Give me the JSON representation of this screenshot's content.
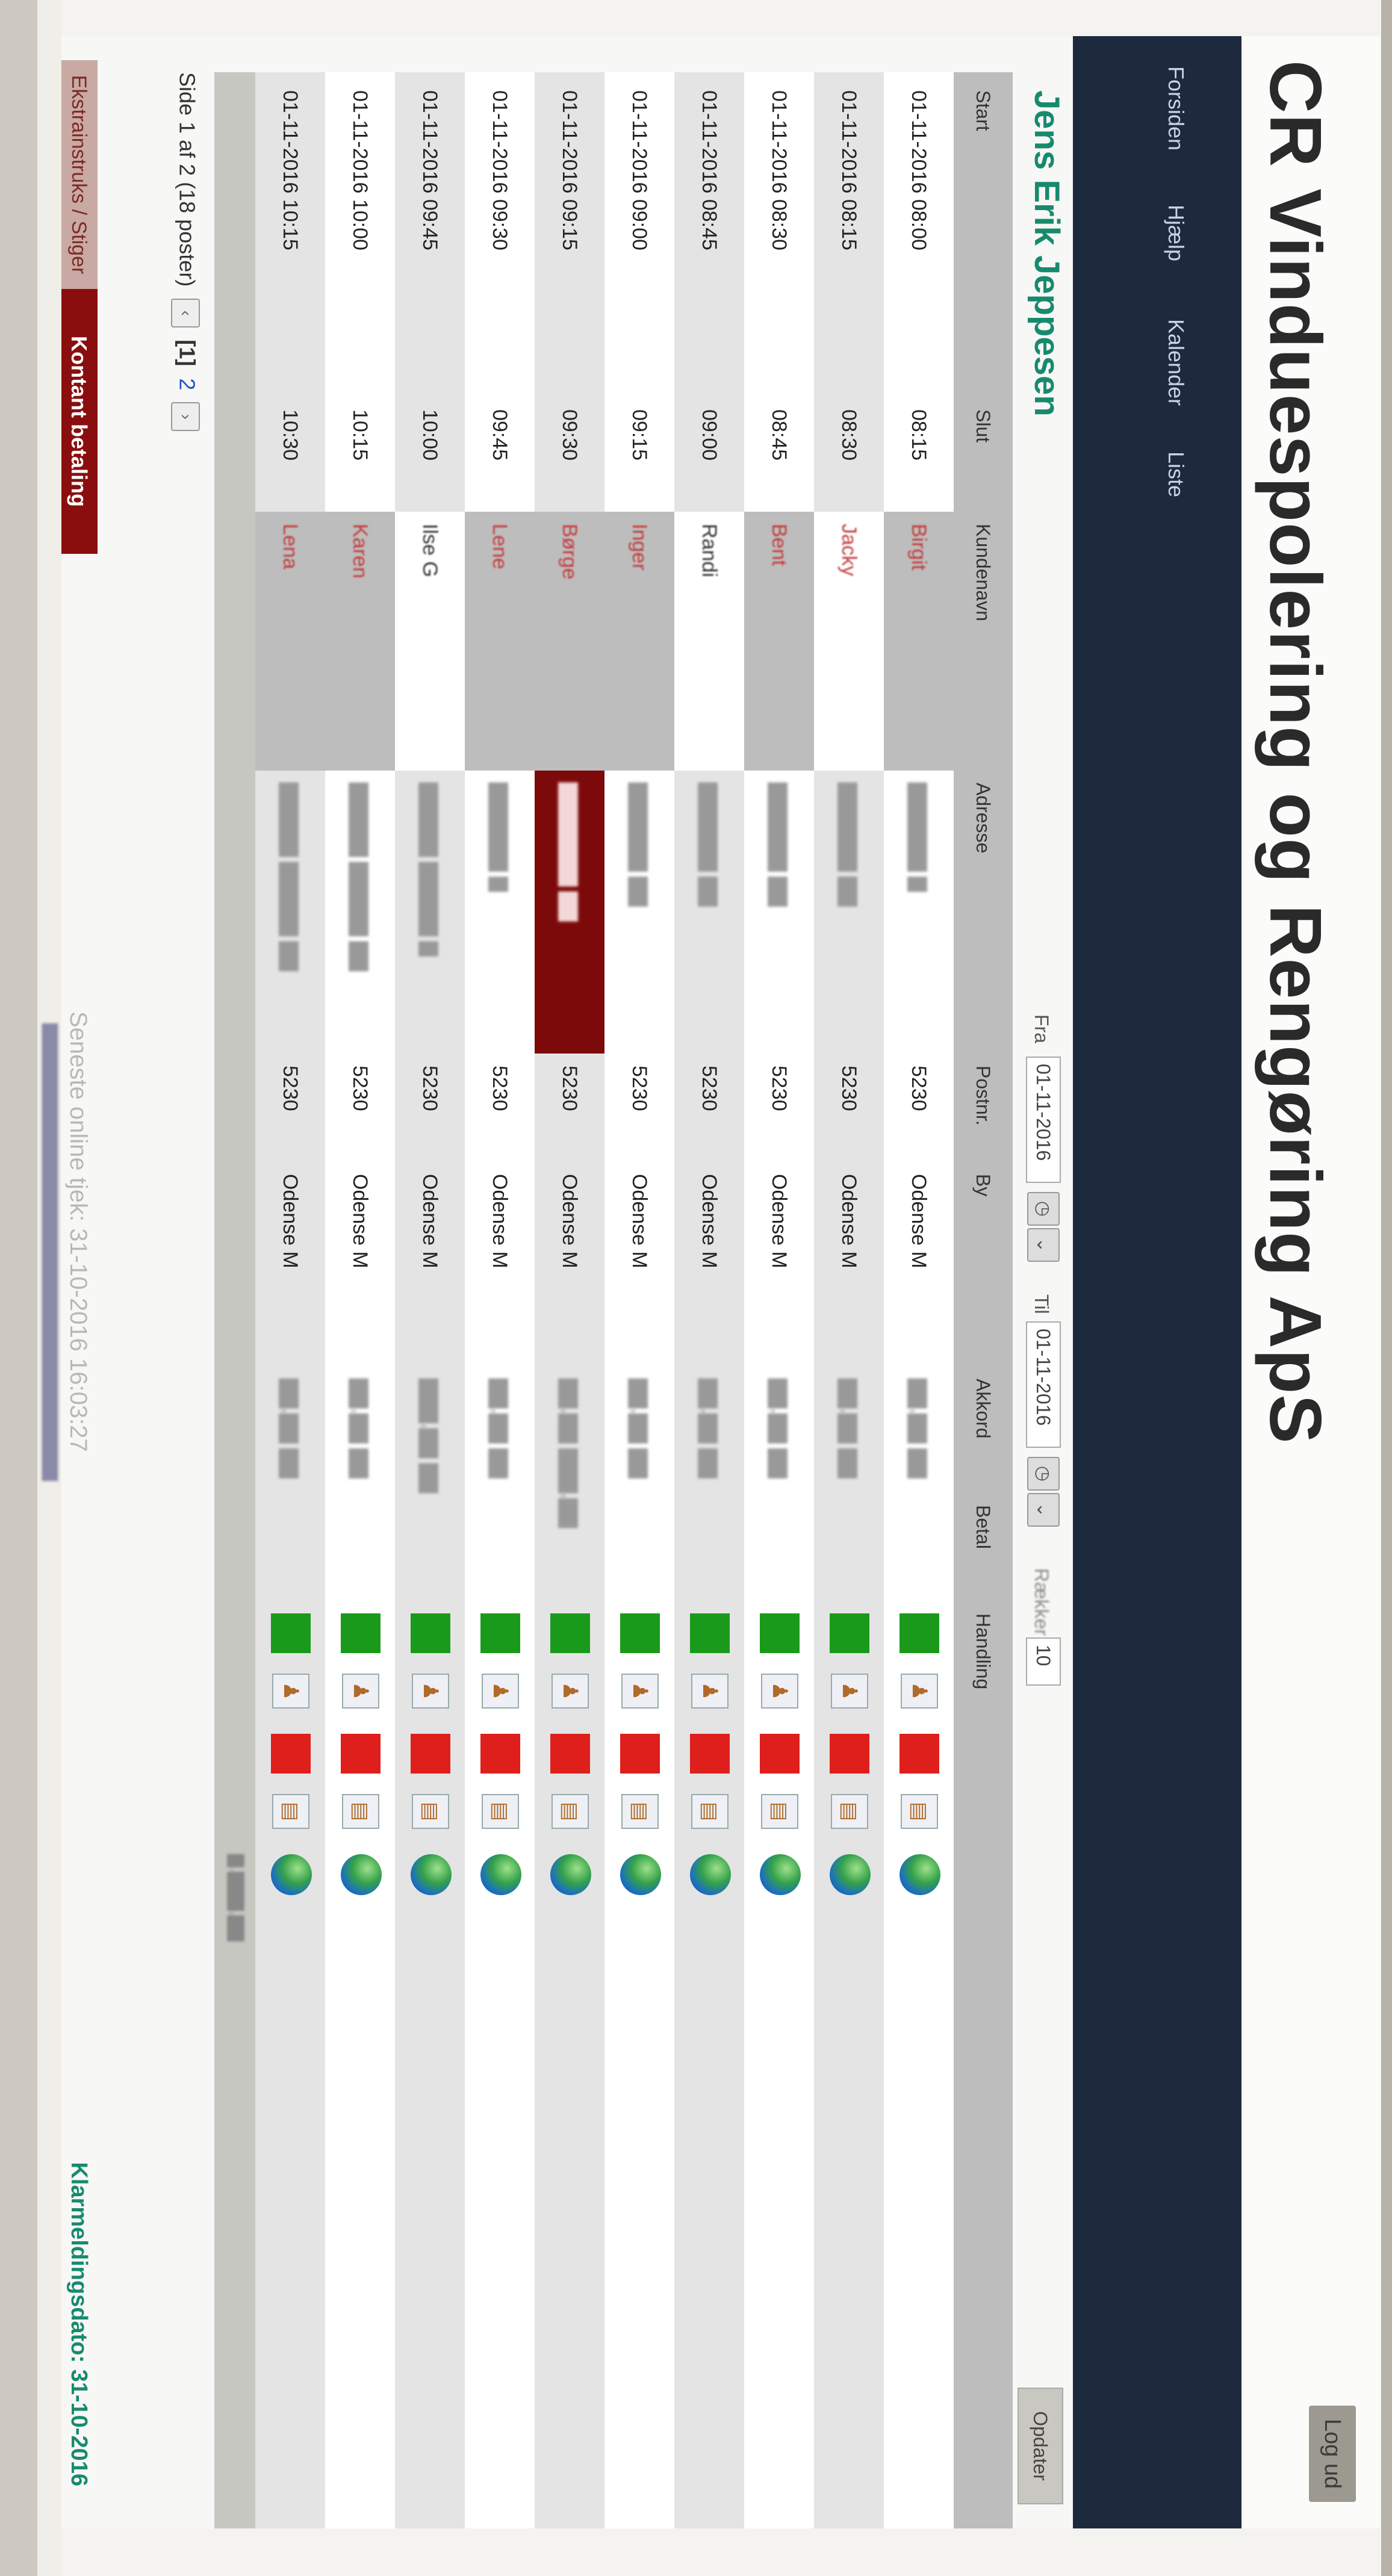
{
  "header": {
    "title": "CR Vinduespolering og Rengøring ApS",
    "logout_label": "Log ud"
  },
  "nav": {
    "items": [
      "Forsiden",
      "Hjælp",
      "Kalender",
      "Liste"
    ]
  },
  "person": {
    "name": "Jens Erik Jeppesen"
  },
  "filters": {
    "from_label": "Fra",
    "from_value": "01-11-2016",
    "to_label": "Til",
    "to_value": "01-11-2016",
    "rows_label": "Rækker",
    "rows_value": "10",
    "update_label": "Opdater"
  },
  "table": {
    "columns": [
      "Start",
      "Slut",
      "Kundenavn",
      "Adresse",
      "Postnr.",
      "By",
      "Akkord",
      "Betal",
      "Handling"
    ],
    "rows": [
      {
        "start": "01-11-2016 08:00",
        "slut": "08:15",
        "kunde": "Birgit",
        "postnr": "5230",
        "by": "Odense M"
      },
      {
        "start": "01-11-2016 08:15",
        "slut": "08:30",
        "kunde": "Jacky",
        "postnr": "5230",
        "by": "Odense M"
      },
      {
        "start": "01-11-2016 08:30",
        "slut": "08:45",
        "kunde": "Bent",
        "postnr": "5230",
        "by": "Odense M"
      },
      {
        "start": "01-11-2016 08:45",
        "slut": "09:00",
        "kunde": "Randi",
        "postnr": "5230",
        "by": "Odense M"
      },
      {
        "start": "01-11-2016 09:00",
        "slut": "09:15",
        "kunde": "Inger",
        "postnr": "5230",
        "by": "Odense M"
      },
      {
        "start": "01-11-2016 09:15",
        "slut": "09:30",
        "kunde": "Børge",
        "postnr": "5230",
        "by": "Odense M"
      },
      {
        "start": "01-11-2016 09:30",
        "slut": "09:45",
        "kunde": "Lene",
        "postnr": "5230",
        "by": "Odense M"
      },
      {
        "start": "01-11-2016 09:45",
        "slut": "10:00",
        "kunde": "Ilse G",
        "postnr": "5230",
        "by": "Odense M"
      },
      {
        "start": "01-11-2016 10:00",
        "slut": "10:15",
        "kunde": "Karen",
        "postnr": "5230",
        "by": "Odense M"
      },
      {
        "start": "01-11-2016 10:15",
        "slut": "10:30",
        "kunde": "Lena",
        "postnr": "5230",
        "by": "Odense M"
      }
    ]
  },
  "pager": {
    "text": "Side 1 af 2 (18 poster)",
    "current": "[1]",
    "next_page": "2"
  },
  "legend": {
    "extra": "Ekstrainstruks / Stiger",
    "cash": "Kontant betaling"
  },
  "footer": {
    "online_check": "Seneste online tjek: 31-10-2016 16:03:27",
    "error_date": "Klarmeldingsdato: 31-10-2016"
  },
  "colors": {
    "nav": "#1d2a3d",
    "accent_green": "#178a6e",
    "status_green": "#1a9a1a",
    "status_red": "#de1f1b",
    "cash_red": "#8a0e0e"
  },
  "icons": [
    "calendar-icon",
    "person-icon",
    "document-icon",
    "globe-icon",
    "chevron-left-icon",
    "chevron-right-icon"
  ]
}
